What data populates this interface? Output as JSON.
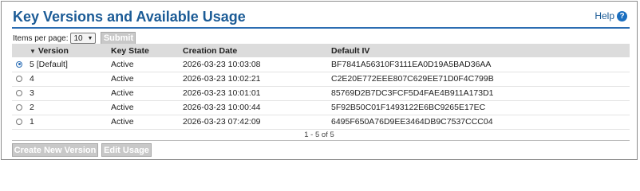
{
  "header": {
    "title": "Key Versions and Available Usage",
    "help_label": "Help",
    "help_icon": "question-circle-icon"
  },
  "paging": {
    "items_per_page_label": "Items per page:",
    "items_per_page_value": "10",
    "submit_label": "Submit",
    "summary": "1 - 5 of 5"
  },
  "table": {
    "columns": [
      "Version",
      "Key State",
      "Creation Date",
      "Default IV"
    ],
    "rows": [
      {
        "selected": true,
        "version": "5 [Default]",
        "state": "Active",
        "created": "2026-03-23 10:03:08",
        "iv": "BF7841A56310F3111EA0D19A5BAD36AA"
      },
      {
        "selected": false,
        "version": "4",
        "state": "Active",
        "created": "2026-03-23 10:02:21",
        "iv": "C2E20E772EEE807C629EE71D0F4C799B"
      },
      {
        "selected": false,
        "version": "3",
        "state": "Active",
        "created": "2026-03-23 10:01:01",
        "iv": "85769D2B7DC3FCF5D4FAE4B911A173D1"
      },
      {
        "selected": false,
        "version": "2",
        "state": "Active",
        "created": "2026-03-23 10:00:44",
        "iv": "5F92B50C01F1493122E6BC9265E17EC"
      },
      {
        "selected": false,
        "version": "1",
        "state": "Active",
        "created": "2026-03-23 07:42:09",
        "iv": "6495F650A76D9EE3464DB9C7537CCC04"
      }
    ]
  },
  "actions": {
    "create_label": "Create New Version",
    "edit_label": "Edit Usage"
  },
  "colors": {
    "title": "#1b5b96",
    "rule": "#2b6db2",
    "disabled_button": "#c8c8c8"
  }
}
